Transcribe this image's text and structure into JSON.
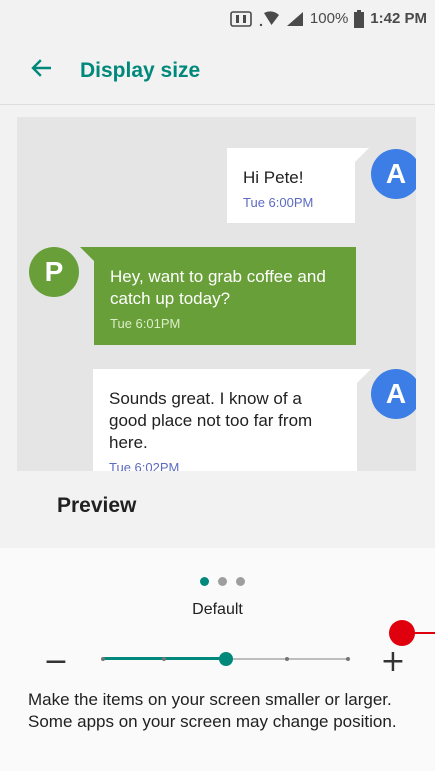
{
  "status_bar": {
    "battery": "100%",
    "time": "1:42 PM"
  },
  "app_bar": {
    "title": "Display size",
    "back_icon": "arrow-back-icon"
  },
  "preview": {
    "messages": [
      {
        "sender_initial": "A",
        "text": "Hi Pete!",
        "time": "Tue 6:00PM"
      },
      {
        "sender_initial": "P",
        "text": "Hey, want to grab coffee and catch up today?",
        "time": "Tue 6:01PM"
      },
      {
        "sender_initial": "A",
        "text": "Sounds great. I know of a good place not too far from here.",
        "time": "Tue 6:02PM"
      }
    ],
    "label": "Preview"
  },
  "controls": {
    "page_dots": 3,
    "active_dot": 0,
    "size_label": "Default",
    "minus_label": "−",
    "plus_label": "+",
    "slider": {
      "steps": 5,
      "value_index": 2
    }
  },
  "description": "Make the items on your screen smaller or larger. Some apps on your screen may change position.",
  "colors": {
    "accent": "#00897b",
    "avatar_blue": "#3d7ee6",
    "green_bubble": "#689f38"
  }
}
